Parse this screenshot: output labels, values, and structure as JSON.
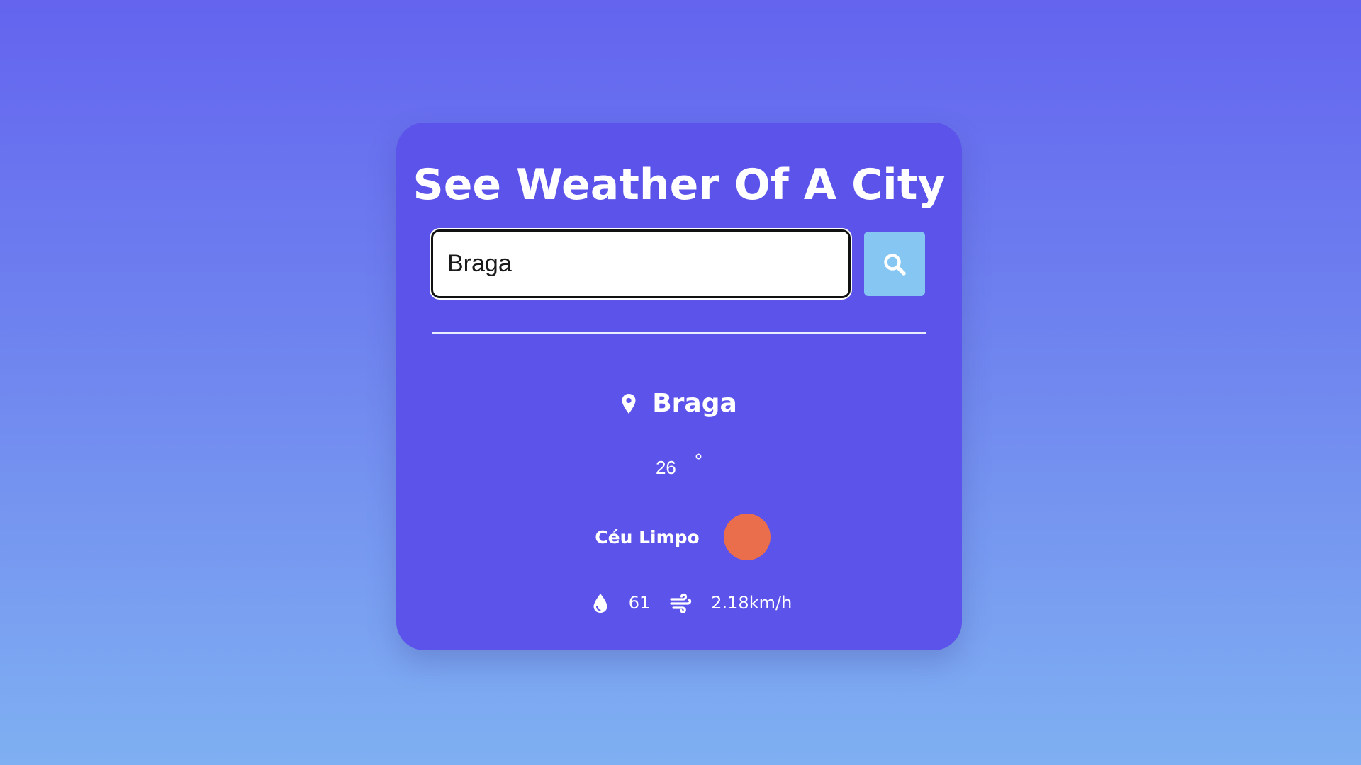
{
  "title": "See Weather Of A City",
  "search": {
    "value": "Braga",
    "button_icon": "search-icon"
  },
  "location": {
    "icon": "map-pin-icon",
    "city": "Braga"
  },
  "temperature": {
    "value": "26",
    "unit": "°"
  },
  "condition": {
    "description": "Céu Limpo",
    "icon": "sun-dot-icon",
    "icon_color": "#ea6e4c"
  },
  "stats": {
    "humidity_icon": "water-drop-icon",
    "humidity": "61",
    "wind_icon": "wind-icon",
    "wind_speed": "2.18km/h"
  },
  "colors": {
    "card": "#5b53ea",
    "button": "#86c6f3",
    "background_top": "#6464ef",
    "background_bottom": "#7fb0f2"
  }
}
